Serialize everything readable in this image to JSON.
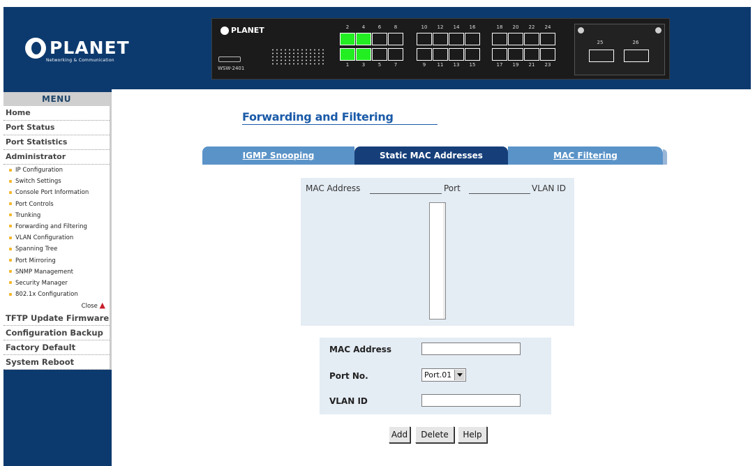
{
  "header": {
    "brand": "PLANET",
    "brand_tagline": "Networking & Communication",
    "switch": {
      "brand": "PLANET",
      "model": "WSW-2401",
      "top_port_numbers": [
        "2",
        "4",
        "6",
        "8",
        "10",
        "12",
        "14",
        "16",
        "18",
        "20",
        "22",
        "24"
      ],
      "bottom_port_numbers": [
        "1",
        "3",
        "5",
        "7",
        "9",
        "11",
        "13",
        "15",
        "17",
        "19",
        "21",
        "23"
      ],
      "active_ports": [
        "1",
        "2",
        "3",
        "4"
      ],
      "uplink_ports": [
        "25",
        "26"
      ],
      "active_color": "#22ee22"
    }
  },
  "menu": {
    "title": "MENU",
    "items_top": [
      "Home",
      "Port Status",
      "Port Statistics",
      "Administrator"
    ],
    "sub_items": [
      "IP Configuration",
      "Switch Settings",
      "Console Port Information",
      "Port Controls",
      "Trunking",
      "Forwarding and Filtering",
      "VLAN Configuration",
      "Spanning Tree",
      "Port Mirroring",
      "SNMP Management",
      "Security Manager",
      "802.1x Configuration"
    ],
    "close_label": "Close",
    "items_bottom": [
      "TFTP Update Firmware",
      "Configuration Backup",
      "Factory Default",
      "System Reboot"
    ],
    "bullet_color": "#f4b72e"
  },
  "page": {
    "title": "Forwarding and Filtering",
    "tabs": [
      "IGMP Snooping",
      "Static MAC Addresses",
      "MAC Filtering"
    ],
    "active_tab": "Static MAC Addresses",
    "list_headers": [
      "MAC Address",
      "Port",
      "VLAN ID"
    ],
    "form": {
      "mac_label": "MAC Address",
      "mac_value": "",
      "port_label": "Port No.",
      "port_value": "Port.01",
      "vlan_label": "VLAN ID",
      "vlan_value": ""
    },
    "buttons": [
      "Add",
      "Delete",
      "Help"
    ]
  },
  "colors": {
    "header_bg": "#0d3a6e",
    "title": "#1a5aa8",
    "active_tab": "#163f7a",
    "inactive_tab": "#5a93c8",
    "panel_bg": "#e4ecf4"
  }
}
